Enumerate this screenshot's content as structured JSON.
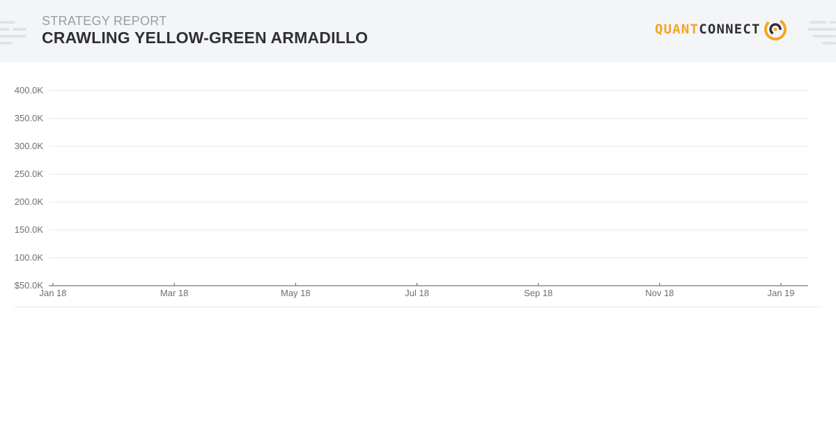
{
  "header": {
    "subtitle": "STRATEGY REPORT",
    "title": "CRAWLING YELLOW-GREEN ARMADILLO",
    "logo": {
      "part1": "QUANT",
      "part2": "CONNECT",
      "icon": "quantconnect-logo-icon",
      "accent": "#f5a623"
    }
  },
  "chart_data": {
    "type": "line",
    "x_ticks": [
      "Jan 18",
      "Mar 18",
      "May 18",
      "Jul 18",
      "Sep 18",
      "Nov 18",
      "Jan 19"
    ],
    "y_ticks": [
      "$50.0K",
      "100.0K",
      "150.0K",
      "200.0K",
      "250.0K",
      "300.0K",
      "350.0K",
      "400.0K"
    ],
    "ylim": [
      50000,
      400000
    ],
    "xlim": [
      "2018-01-01",
      "2019-01-01"
    ],
    "series": [],
    "grid": true,
    "colors": {
      "grid": "#e6e7ea",
      "axis": "#555555",
      "label": "#6b6e75"
    }
  }
}
